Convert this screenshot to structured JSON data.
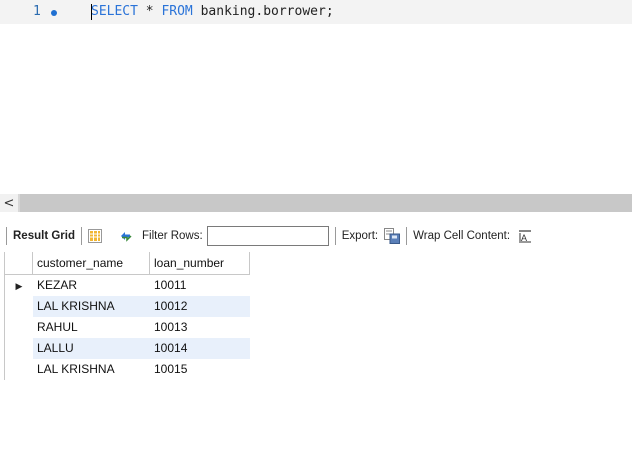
{
  "editor": {
    "line_number": "1",
    "keyword_select": "SELECT",
    "code_middle": " * ",
    "keyword_from": "FROM",
    "code_rest": " banking.borrower;"
  },
  "scrollbar": {
    "left_arrow": "<"
  },
  "toolbar": {
    "result_grid_label": "Result Grid",
    "filter_rows_label": "Filter Rows:",
    "filter_value": "",
    "export_label": "Export:",
    "wrap_label": "Wrap Cell Content:",
    "icons": [
      "grid-layout-icon",
      "refresh-icon",
      "export-icon",
      "wrap-text-icon"
    ]
  },
  "grid": {
    "columns": [
      "customer_name",
      "loan_number"
    ],
    "rows": [
      {
        "customer_name": "KEZAR",
        "loan_number": "10011"
      },
      {
        "customer_name": "LAL KRISHNA",
        "loan_number": "10012"
      },
      {
        "customer_name": "RAHUL",
        "loan_number": "10013"
      },
      {
        "customer_name": "LALLU",
        "loan_number": "10014"
      },
      {
        "customer_name": "LAL KRISHNA",
        "loan_number": "10015"
      }
    ],
    "current_row_marker": "▶"
  },
  "colors": {
    "keyword": "#2a73d8",
    "alt_row": "#e8f0fb",
    "line_dot": "#1f6fd1"
  }
}
